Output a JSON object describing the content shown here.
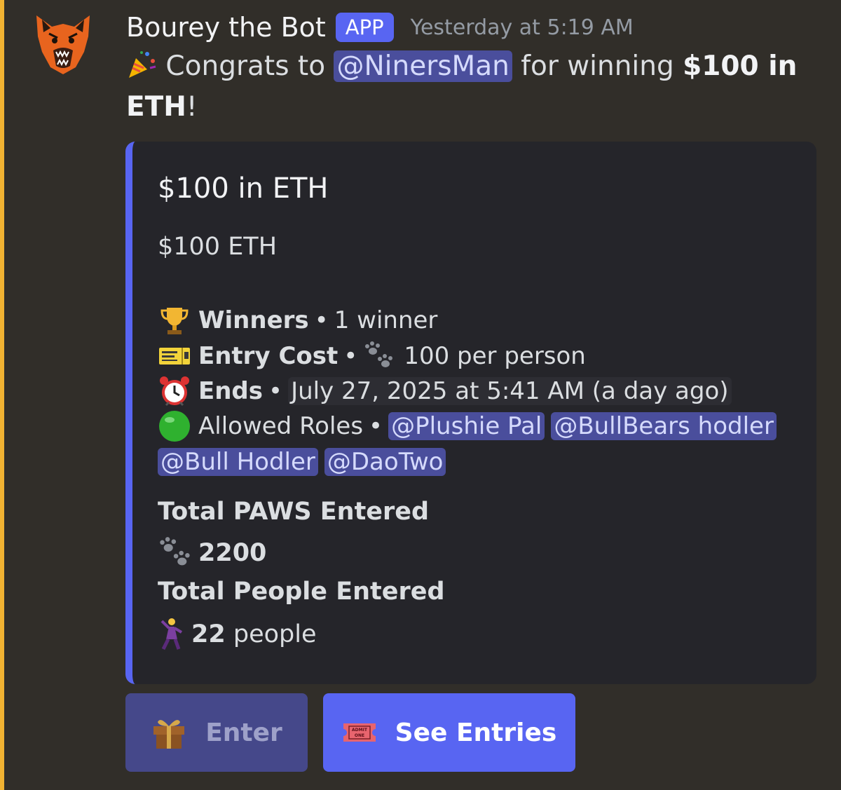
{
  "colors": {
    "accent": "#5865f2",
    "mention_bar": "#f0b232",
    "background": "#312e29",
    "embed_bg": "#25252a"
  },
  "message": {
    "author": "Bourey the Bot",
    "badge": "APP",
    "timestamp": "Yesterday at 5:19 AM",
    "avatar_icon": "bear-head-icon",
    "text_pre": "Congrats to",
    "winner_mention": "@NinersMan",
    "text_mid": "for winning",
    "prize_bold": "$100 in ETH",
    "text_end": "!"
  },
  "embed": {
    "title": "$100 in ETH",
    "description": "$100 ETH",
    "winners_label": "Winners",
    "winners_value": "1 winner",
    "entry_cost_label": "Entry Cost",
    "entry_cost_value": "100 per person",
    "ends_label": "Ends",
    "ends_value": "July 27, 2025 at 5:41 AM",
    "ends_relative": "(a day ago)",
    "allowed_roles_label": "Allowed Roles",
    "roles": [
      "@Plushie Pal",
      "@BullBears hodler",
      "@Bull Hodler",
      "@DaoTwo"
    ],
    "paws_label": "Total PAWS Entered",
    "paws_value": "2200",
    "people_label": "Total People Entered",
    "people_count": "22",
    "people_unit": "people"
  },
  "buttons": {
    "enter": "Enter",
    "see_entries": "See Entries"
  }
}
